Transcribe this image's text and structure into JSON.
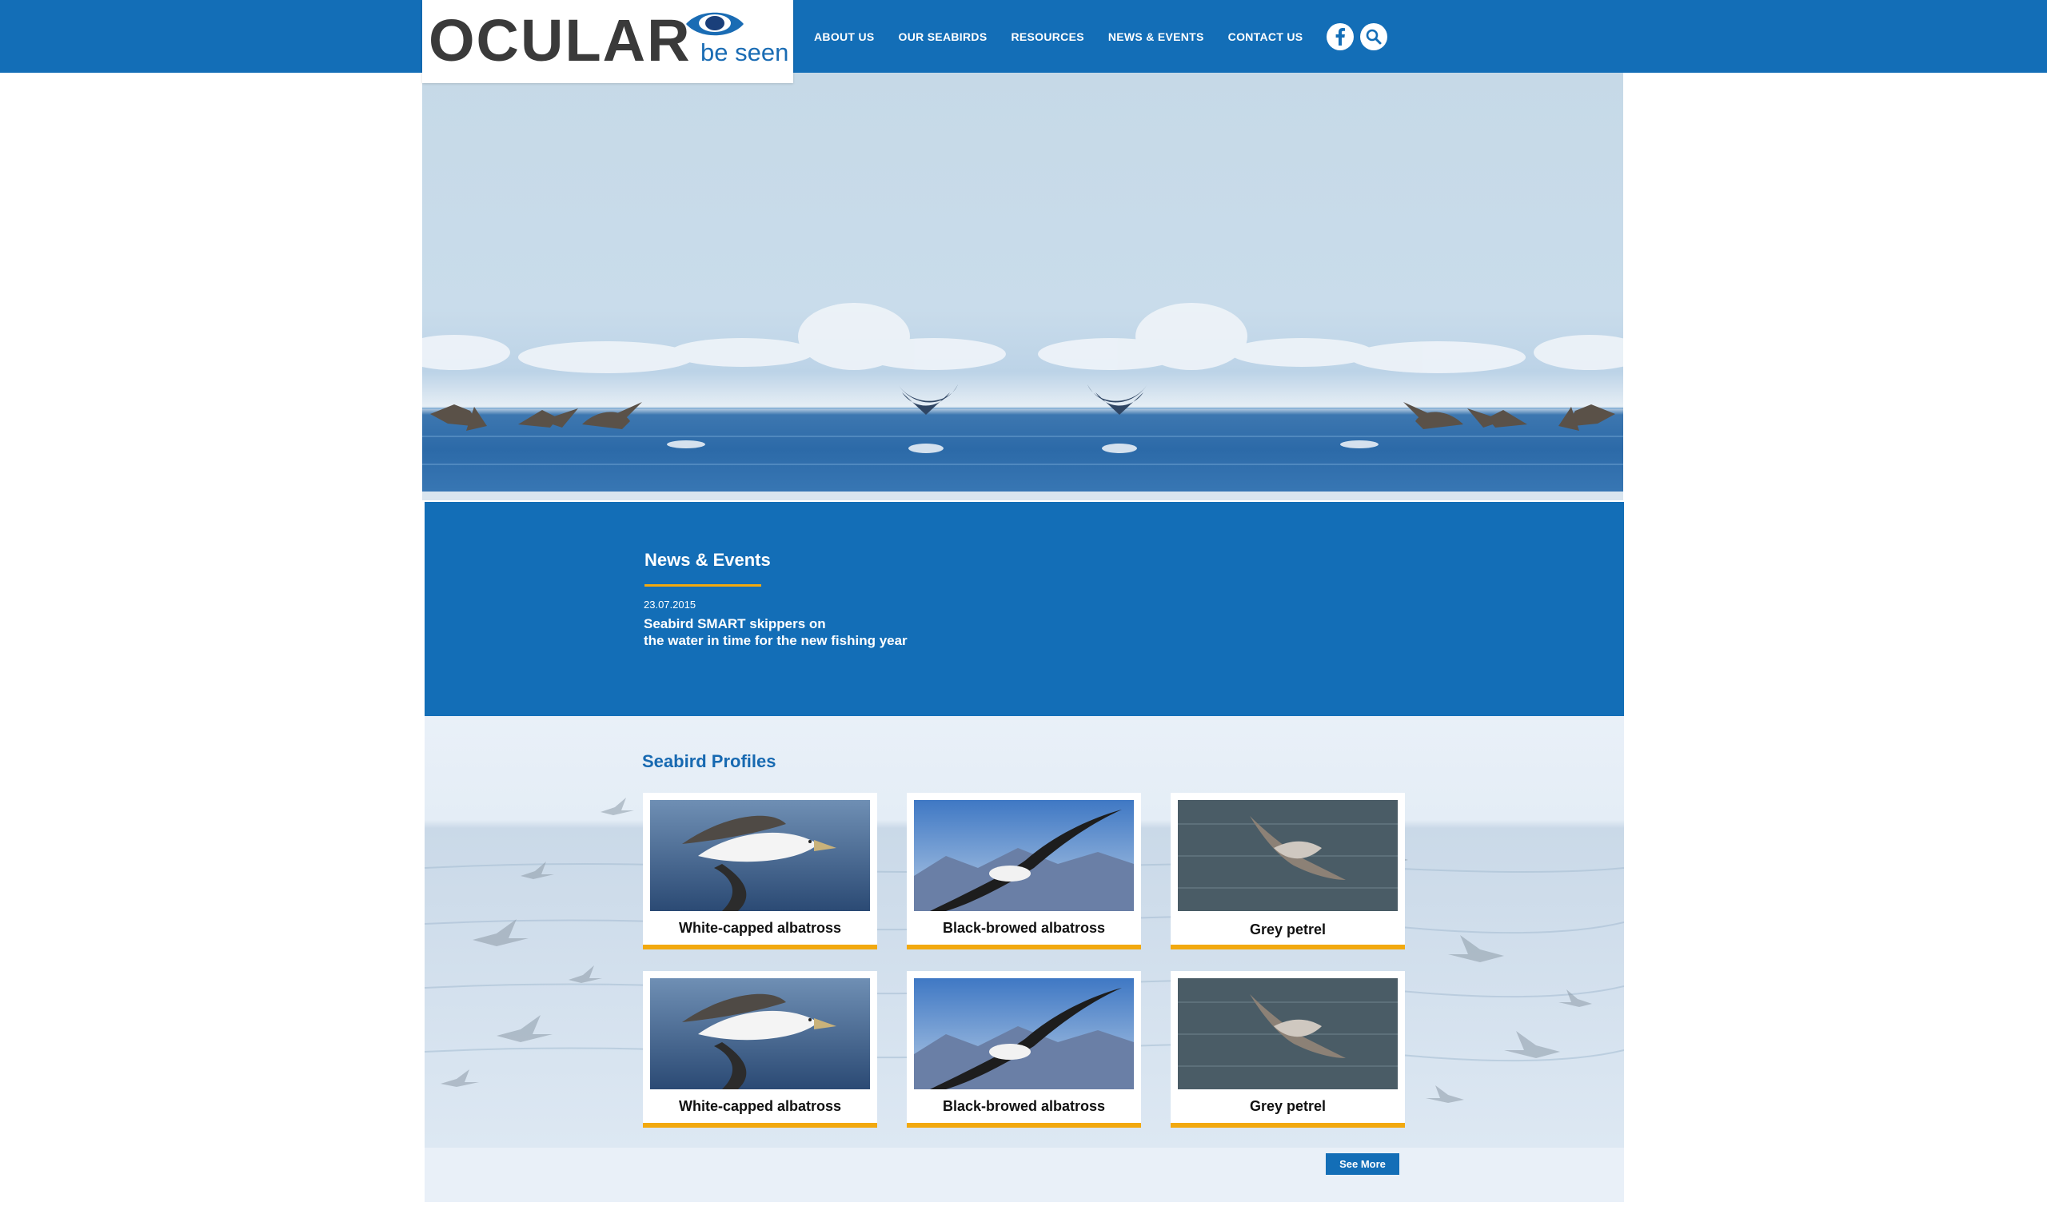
{
  "header": {
    "logo": {
      "word": "OCULAR",
      "tagline": "be seen"
    },
    "nav": [
      "ABOUT US",
      "OUR SEABIRDS",
      "RESOURCES",
      "NEWS & EVENTS",
      "CONTACT US"
    ],
    "icons": [
      "facebook-icon",
      "search-icon"
    ]
  },
  "news": {
    "title": "News & Events",
    "date": "23.07.2015",
    "headline_line1": "Seabird SMART skippers on",
    "headline_line2": "the water in time for the new fishing year"
  },
  "profiles": {
    "title": "Seabird Profiles",
    "cards": [
      {
        "name": "White-capped albatross"
      },
      {
        "name": "Black-browed albatross"
      },
      {
        "name": "Grey petrel"
      },
      {
        "name": "White-capped albatross"
      },
      {
        "name": "Black-browed albatross"
      },
      {
        "name": "Grey petrel"
      }
    ],
    "see_more": "See More"
  },
  "colors": {
    "brand_blue": "#136eb7",
    "accent": "#f2a90f",
    "profile_bg": "#e9f0f8"
  }
}
